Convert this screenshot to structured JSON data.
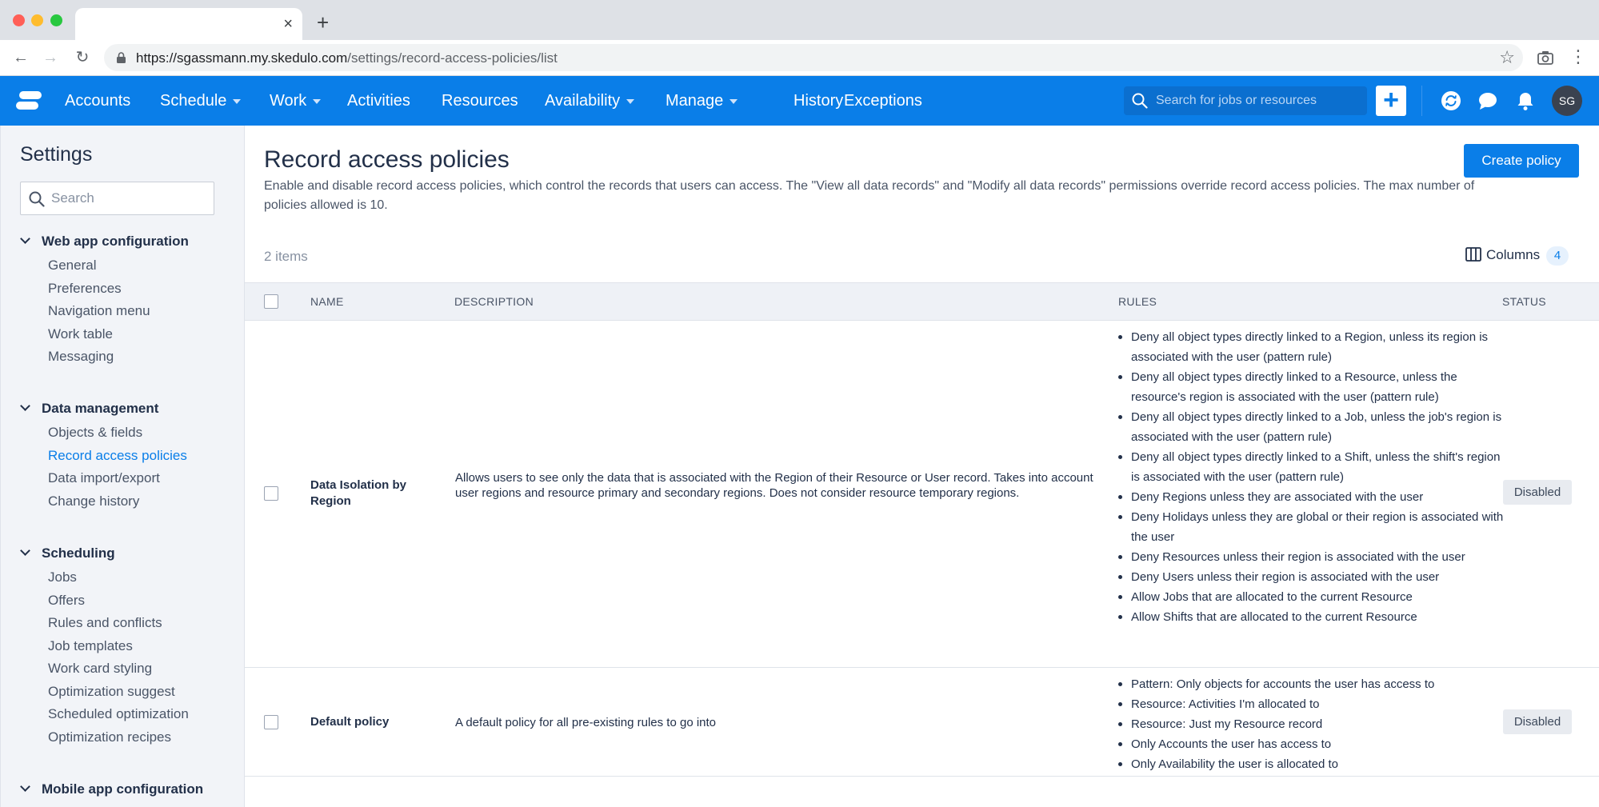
{
  "browser": {
    "url_host": "https://sgassmann.my.skedulo.com",
    "url_path": "/settings/record-access-policies/list",
    "tab_close": "×",
    "new_tab": "+"
  },
  "nav": {
    "items": [
      {
        "label": "Accounts",
        "dropdown": false
      },
      {
        "label": "Schedule",
        "dropdown": true
      },
      {
        "label": "Work",
        "dropdown": true
      },
      {
        "label": "Activities",
        "dropdown": false
      },
      {
        "label": "Resources",
        "dropdown": false
      },
      {
        "label": "Availability",
        "dropdown": true
      },
      {
        "label": "Manage",
        "dropdown": true
      },
      {
        "label": "History",
        "dropdown": false
      },
      {
        "label": "Exceptions",
        "dropdown": false
      }
    ],
    "search_placeholder": "Search for jobs or resources",
    "add_label": "+",
    "avatar_initials": "SG"
  },
  "sidebar": {
    "title": "Settings",
    "search_placeholder": "Search",
    "sections": [
      {
        "title": "Web app configuration",
        "items": [
          "General",
          "Preferences",
          "Navigation menu",
          "Work table",
          "Messaging"
        ]
      },
      {
        "title": "Data management",
        "items": [
          "Objects & fields",
          "Record access policies",
          "Data import/export",
          "Change history"
        ]
      },
      {
        "title": "Scheduling",
        "items": [
          "Jobs",
          "Offers",
          "Rules and conflicts",
          "Job templates",
          "Work card styling",
          "Optimization suggest",
          "Scheduled optimization",
          "Optimization recipes"
        ]
      },
      {
        "title": "Mobile app configuration",
        "items": []
      }
    ],
    "active_item": "Record access policies"
  },
  "main": {
    "title": "Record access policies",
    "description": "Enable and disable record access policies, which control the records that users can access. The \"View all data records\" and \"Modify all data records\" permissions override record access policies. The max number of policies allowed is 10.",
    "create_button": "Create policy",
    "items_count": "2 items",
    "columns_label": "Columns",
    "columns_count": "4",
    "table": {
      "headers": {
        "name": "NAME",
        "description": "DESCRIPTION",
        "rules": "RULES",
        "status": "STATUS"
      },
      "rows": [
        {
          "name": "Data Isolation by Region",
          "description": "Allows users to see only the data that is associated with the Region of their Resource or User record. Takes into account user regions and resource primary and secondary regions. Does not consider resource temporary regions.",
          "rules": [
            "Deny all object types directly linked to a Region, unless its region is associated with the user (pattern rule)",
            "Deny all object types directly linked to a Resource, unless the resource's region is associated with the user (pattern rule)",
            "Deny all object types directly linked to a Job, unless the job's region is associated with the user (pattern rule)",
            "Deny all object types directly linked to a Shift, unless the shift's region is associated with the user (pattern rule)",
            "Deny Regions unless they are associated with the user",
            "Deny Holidays unless they are global or their region is associated with the user",
            "Deny Resources unless their region is associated with the user",
            "Deny Users unless their region is associated with the user",
            "Allow Jobs that are allocated to the current Resource",
            "Allow Shifts that are allocated to the current Resource"
          ],
          "status": "Disabled"
        },
        {
          "name": "Default policy",
          "description": "A default policy for all pre-existing rules to go into",
          "rules": [
            "Pattern: Only objects for accounts the user has access to",
            "Resource: Activities I'm allocated to",
            "Resource: Just my Resource record",
            "Only Accounts the user has access to",
            "Only Availability the user is allocated to"
          ],
          "status": "Disabled"
        }
      ]
    }
  },
  "colors": {
    "brand": "#0a7ee8",
    "sidebar_bg": "#f2f4f8",
    "table_header_bg": "#eef1f6"
  }
}
